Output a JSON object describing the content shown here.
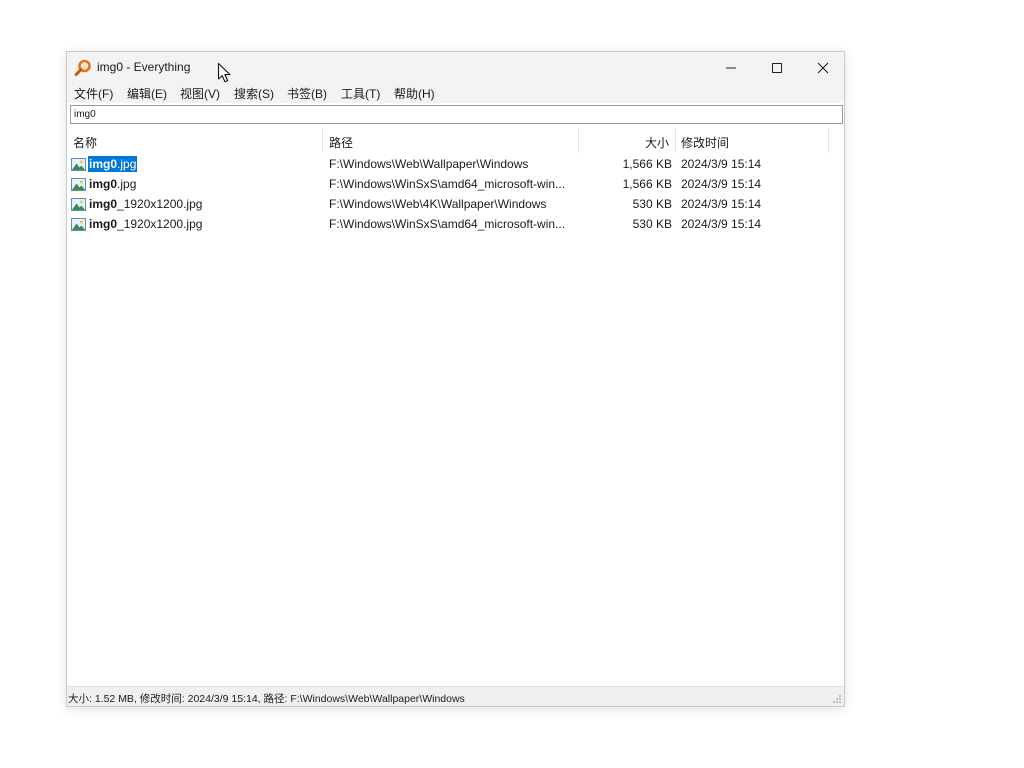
{
  "window": {
    "title": "img0 - Everything",
    "controls": {
      "minimize": "minimize-icon",
      "maximize": "maximize-icon",
      "close": "close-icon"
    }
  },
  "menu": [
    "文件(F)",
    "编辑(E)",
    "视图(V)",
    "搜索(S)",
    "书签(B)",
    "工具(T)",
    "帮助(H)"
  ],
  "search": {
    "value": "img0"
  },
  "columns": {
    "name": "名称",
    "path": "路径",
    "size": "大小",
    "modified": "修改时间"
  },
  "rows": [
    {
      "name_bold": "img0",
      "name_rest": ".jpg",
      "path": "F:\\Windows\\Web\\Wallpaper\\Windows",
      "size": "1,566 KB",
      "modified": "2024/3/9 15:14",
      "selected": true
    },
    {
      "name_bold": "img0",
      "name_rest": ".jpg",
      "path": "F:\\Windows\\WinSxS\\amd64_microsoft-win...",
      "size": "1,566 KB",
      "modified": "2024/3/9 15:14"
    },
    {
      "name_bold": "img0",
      "name_rest": "_1920x1200.jpg",
      "path": "F:\\Windows\\Web\\4K\\Wallpaper\\Windows",
      "size": "530 KB",
      "modified": "2024/3/9 15:14"
    },
    {
      "name_bold": "img0",
      "name_rest": "_1920x1200.jpg",
      "path": "F:\\Windows\\WinSxS\\amd64_microsoft-win...",
      "size": "530 KB",
      "modified": "2024/3/9 15:14"
    }
  ],
  "status": {
    "text": "大小: 1.52 MB, 修改时间: 2024/3/9 15:14, 路径: F:\\Windows\\Web\\Wallpaper\\Windows"
  },
  "colors": {
    "selection": "#0078d7",
    "titlebar": "#f3f3f3",
    "app_icon": "#e8731a"
  }
}
